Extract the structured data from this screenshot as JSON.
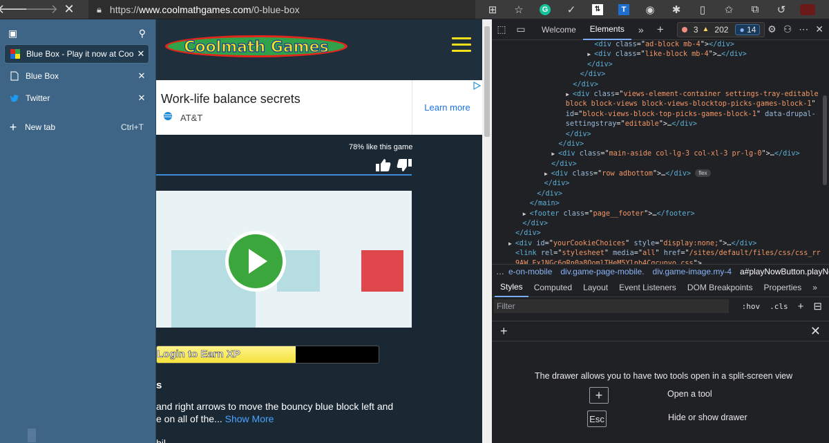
{
  "browser": {
    "url_prefix": "https://",
    "url_host": "www.coolmathgames.com",
    "url_path": "/0-blue-box"
  },
  "vertical_tabs": {
    "tabs": [
      {
        "title": "Blue Box - Play it now at Coolmath Games",
        "active": true,
        "favicon": "coolmath-favicon-icon"
      },
      {
        "title": "Blue Box",
        "active": false,
        "favicon": "page-icon"
      },
      {
        "title": "Twitter",
        "active": false,
        "favicon": "twitter-bird-icon"
      }
    ],
    "new_tab_label": "New tab",
    "new_tab_shortcut": "Ctrl+T"
  },
  "page": {
    "logo_text": "Coolmath Games",
    "ad": {
      "title": "Work-life balance secrets",
      "brand": "AT&T",
      "link": "Learn more"
    },
    "like_text": "78% like this game",
    "xp_label": "Login to Earn XP",
    "xp_fraction": 0.625,
    "instructions_heading": "s",
    "instructions_line1": "and right arrows to move the bouncy blue block left and",
    "instructions_line2": "e on all of the... ",
    "show_more": "Show More",
    "cut_text": "bil"
  },
  "devtools": {
    "tabs": [
      "Welcome",
      "Elements"
    ],
    "active_tab": "Elements",
    "errors": "3",
    "warnings": "202",
    "info": "14",
    "breadcrumbs": [
      "…",
      "e-on-mobile",
      "div.game-page-mobile.",
      "div.game-image.my-4",
      "a#playNowButton.playNow"
    ],
    "sub_tabs": [
      "Styles",
      "Computed",
      "Layout",
      "Event Listeners",
      "DOM Breakpoints",
      "Properties"
    ],
    "active_sub_tab": "Styles",
    "filter_placeholder": "Filter",
    "hov": ":hov",
    "cls": ".cls",
    "drawer_message": "The drawer allows you to have two tools open in a split-screen view",
    "open_tool_label": "Open a tool",
    "hide_drawer_label": "Hide or show drawer",
    "esc_key": "Esc",
    "dom_lines": [
      {
        "indent": 14,
        "caret": false,
        "parts": [
          [
            "tag",
            "<div "
          ],
          [
            "attr",
            "class"
          ],
          [
            "txt",
            "=\""
          ],
          [
            "val",
            "ad-block mb-4"
          ],
          [
            "txt",
            "\">"
          ],
          [
            "tag",
            "</div>"
          ]
        ]
      },
      {
        "indent": 14,
        "caret": true,
        "parts": [
          [
            "tag",
            "<div "
          ],
          [
            "attr",
            "class"
          ],
          [
            "txt",
            "=\""
          ],
          [
            "val",
            "like-block mb-4"
          ],
          [
            "txt",
            "\">…"
          ],
          [
            "tag",
            "</div>"
          ]
        ]
      },
      {
        "indent": 13,
        "caret": false,
        "parts": [
          [
            "tag",
            "</div>"
          ]
        ]
      },
      {
        "indent": 12,
        "caret": false,
        "parts": [
          [
            "tag",
            "</div>"
          ]
        ]
      },
      {
        "indent": 11,
        "caret": false,
        "parts": [
          [
            "tag",
            "</div>"
          ]
        ]
      },
      {
        "indent": 11,
        "caret": true,
        "parts": [
          [
            "tag",
            "<div "
          ],
          [
            "attr",
            "class"
          ],
          [
            "txt",
            "=\""
          ],
          [
            "val",
            "views-element-container settings-tray-editable"
          ]
        ]
      },
      {
        "indent": 10,
        "caret": false,
        "parts": [
          [
            "val",
            "block block-views block-views-blocktop-picks-games-block-1"
          ],
          [
            "txt",
            "\""
          ]
        ]
      },
      {
        "indent": 10,
        "caret": false,
        "parts": [
          [
            "attr",
            "id"
          ],
          [
            "txt",
            "=\""
          ],
          [
            "val",
            "block-views-block-top-picks-games-block-1"
          ],
          [
            "txt",
            "\" "
          ],
          [
            "attr",
            "data-drupal-"
          ]
        ]
      },
      {
        "indent": 10,
        "caret": false,
        "parts": [
          [
            "attr",
            "settingstray"
          ],
          [
            "txt",
            "=\""
          ],
          [
            "val",
            "editable"
          ],
          [
            "txt",
            "\">…"
          ],
          [
            "tag",
            "</div>"
          ]
        ]
      },
      {
        "indent": 10,
        "caret": false,
        "parts": [
          [
            "tag",
            "</div>"
          ]
        ]
      },
      {
        "indent": 9,
        "caret": false,
        "parts": [
          [
            "tag",
            "</div>"
          ]
        ]
      },
      {
        "indent": 9,
        "caret": true,
        "parts": [
          [
            "tag",
            "<div "
          ],
          [
            "attr",
            "class"
          ],
          [
            "txt",
            "=\""
          ],
          [
            "val",
            "main-aside col-lg-3 col-xl-3 pr-lg-0"
          ],
          [
            "txt",
            "\">…"
          ],
          [
            "tag",
            "</div>"
          ]
        ]
      },
      {
        "indent": 8,
        "caret": false,
        "parts": [
          [
            "tag",
            "</div>"
          ]
        ]
      },
      {
        "indent": 8,
        "caret": true,
        "parts": [
          [
            "tag",
            "<div "
          ],
          [
            "attr",
            "class"
          ],
          [
            "txt",
            "=\""
          ],
          [
            "val",
            "row adbottom"
          ],
          [
            "txt",
            "\">…"
          ],
          [
            "tag",
            "</div>"
          ]
        ],
        "badge": "flex"
      },
      {
        "indent": 7,
        "caret": false,
        "parts": [
          [
            "tag",
            "</div>"
          ]
        ]
      },
      {
        "indent": 6,
        "caret": false,
        "parts": [
          [
            "tag",
            "</div>"
          ]
        ]
      },
      {
        "indent": 5,
        "caret": false,
        "parts": [
          [
            "tag",
            "</main>"
          ]
        ]
      },
      {
        "indent": 5,
        "caret": true,
        "parts": [
          [
            "tag",
            "<footer "
          ],
          [
            "attr",
            "class"
          ],
          [
            "txt",
            "=\""
          ],
          [
            "val",
            "page__footer"
          ],
          [
            "txt",
            "\">…"
          ],
          [
            "tag",
            "</footer>"
          ]
        ]
      },
      {
        "indent": 4,
        "caret": false,
        "parts": [
          [
            "tag",
            "</div>"
          ]
        ]
      },
      {
        "indent": 3,
        "caret": false,
        "parts": [
          [
            "tag",
            "</div>"
          ]
        ]
      },
      {
        "indent": 3,
        "caret": true,
        "parts": [
          [
            "tag",
            "<div "
          ],
          [
            "attr",
            "id"
          ],
          [
            "txt",
            "=\""
          ],
          [
            "val",
            "yourCookieChoices"
          ],
          [
            "txt",
            "\" "
          ],
          [
            "attr",
            "style"
          ],
          [
            "txt",
            "=\""
          ],
          [
            "val",
            "display:none;"
          ],
          [
            "txt",
            "\">…"
          ],
          [
            "tag",
            "</div>"
          ]
        ]
      },
      {
        "indent": 3,
        "caret": false,
        "parts": [
          [
            "tag",
            "<link "
          ],
          [
            "attr",
            "rel"
          ],
          [
            "txt",
            "=\""
          ],
          [
            "val",
            "stylesheet"
          ],
          [
            "txt",
            "\" "
          ],
          [
            "attr",
            "media"
          ],
          [
            "txt",
            "=\""
          ],
          [
            "val",
            "all"
          ],
          [
            "txt",
            "\" "
          ],
          [
            "attr",
            "href"
          ],
          [
            "txt",
            "=\""
          ],
          [
            "val",
            "/sites/default/files/css/css_rrlke"
          ]
        ]
      },
      {
        "indent": 3,
        "caret": false,
        "parts": [
          [
            "val",
            "9AW_Ex1NGc6gRn0a8OomlTHeM5Ylpb4Cqcupyo.css"
          ],
          [
            "txt",
            "\">"
          ]
        ]
      }
    ]
  }
}
